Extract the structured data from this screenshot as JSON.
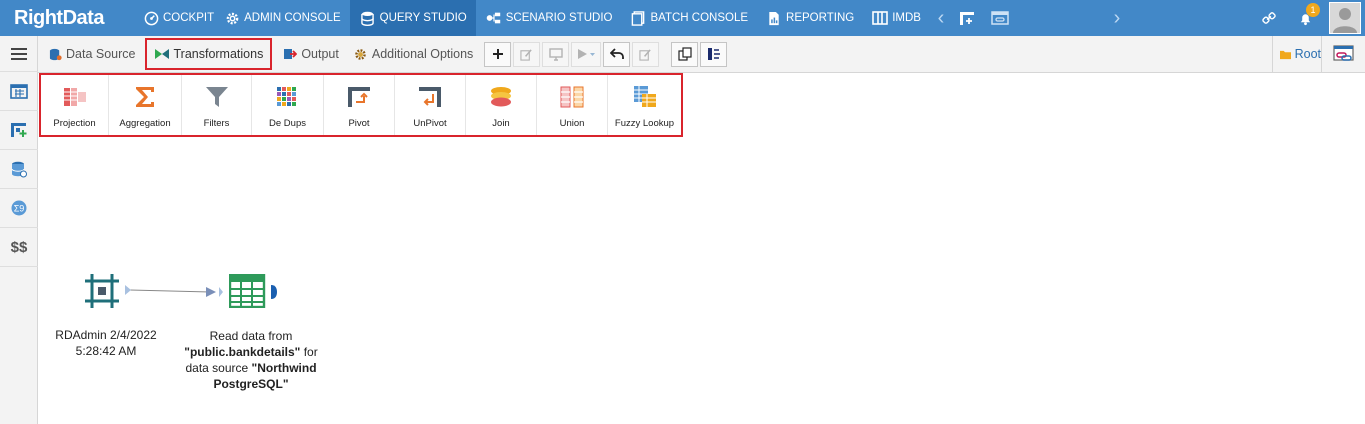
{
  "brand": {
    "logo_text": "RightData"
  },
  "topnav": {
    "items": [
      {
        "label": "COCKPIT",
        "icon": "cockpit-icon"
      },
      {
        "label": "ADMIN CONSOLE",
        "icon": "gear-icon"
      },
      {
        "label": "QUERY STUDIO",
        "icon": "database-icon",
        "active": true
      },
      {
        "label": "SCENARIO STUDIO",
        "icon": "scenario-icon"
      },
      {
        "label": "BATCH CONSOLE",
        "icon": "batch-icon"
      },
      {
        "label": "REPORTING",
        "icon": "report-icon"
      },
      {
        "label": "IMDB",
        "icon": "imdb-icon"
      }
    ],
    "notification_count": "1"
  },
  "toolbar": {
    "data_source": "Data Source",
    "transformations": "Transformations",
    "output": "Output",
    "additional_options": "Additional Options",
    "root": "Root"
  },
  "ribbon": {
    "items": [
      {
        "label": "Projection"
      },
      {
        "label": "Aggregation"
      },
      {
        "label": "Filters"
      },
      {
        "label": "De Dups"
      },
      {
        "label": "Pivot"
      },
      {
        "label": "UnPivot"
      },
      {
        "label": "Join"
      },
      {
        "label": "Union"
      },
      {
        "label": "Fuzzy  Lookup"
      }
    ]
  },
  "canvas": {
    "node1": {
      "line1": "RDAdmin 2/4/2022",
      "line2": "5:28:42 AM"
    },
    "node2": {
      "t1": "Read data from",
      "b1": "\"public.bankdetails\"",
      "t2": " for",
      "t3": "data source ",
      "b2": "\"Northwind",
      "b3": "PostgreSQL\""
    }
  },
  "leftrail": {
    "dollar_label": "$$"
  },
  "colors": {
    "nav_bg": "#4288c8",
    "nav_active": "#2b6fb0",
    "highlight_red": "#d9242c",
    "node_teal": "#1f6f7a",
    "node_green": "#2e9a5a"
  }
}
